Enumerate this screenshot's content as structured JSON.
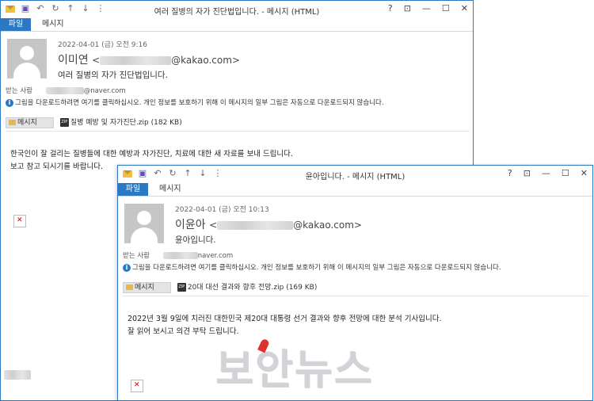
{
  "window1": {
    "title": "여러 질병의 자가 진단법입니다. - 메시지 (HTML)",
    "tab_file": "파일",
    "tab_message": "메시지",
    "date": "2022-04-01 (금) 오전 9:16",
    "sender_name": "이미연",
    "sender_open": "<",
    "sender_domain": "@kakao.com>",
    "subject": "여러 질병의 자가 진단법입니다.",
    "to_label": "받는 사람",
    "to_domain": "@naver.com",
    "info": "그림을 다운로드하려면 여기를 클릭하십시오. 개인 정보를 보호하기 위해 이 메시지의 일부 그림은 자동으로 다운로드되지 않습니다.",
    "attach_message": "메시지",
    "attach_file": "질병 예방 및 자가진단.zip (182 KB)",
    "body_line1": "한국인이 잘 걸리는 질병들에 대한 예방과 자가진단, 치료에 대한 새 자료를 보내 드립니다.",
    "body_line2": "보고 참고 되시기를 바랍니다."
  },
  "window2": {
    "title": "윤아입니다. - 메시지 (HTML)",
    "tab_file": "파일",
    "tab_message": "메시지",
    "date": "2022-04-01 (금) 오전 10:13",
    "sender_name": "이윤아",
    "sender_open": "<",
    "sender_domain": "@kakao.com>",
    "subject": "윤아입니다.",
    "to_label": "받는 사람",
    "to_domain": "naver.com",
    "info": "그림을 다운로드하려면 여기를 클릭하십시오. 개인 정보를 보호하기 위해 이 메시지의 일부 그림은 자동으로 다운로드되지 않습니다.",
    "attach_message": "메시지",
    "attach_file": "20대 대선 결과와 향후 전망.zip (169 KB)",
    "body_line1": "2022년 3월 9일에 치러진 대한민국 제20대 대통령 선거 결과와 향후 전망에 대한 분석 기사입니다.",
    "body_line2": "잘 읽어 보시고 의견 부탁 드립니다."
  },
  "titlebar_buttons": {
    "help": "?",
    "minimize": "—",
    "maximize": "☐",
    "close": "✕"
  },
  "watermark": "보안뉴스",
  "colors": {
    "accent": "#2b79c2",
    "watermark_pin": "#e03030"
  }
}
